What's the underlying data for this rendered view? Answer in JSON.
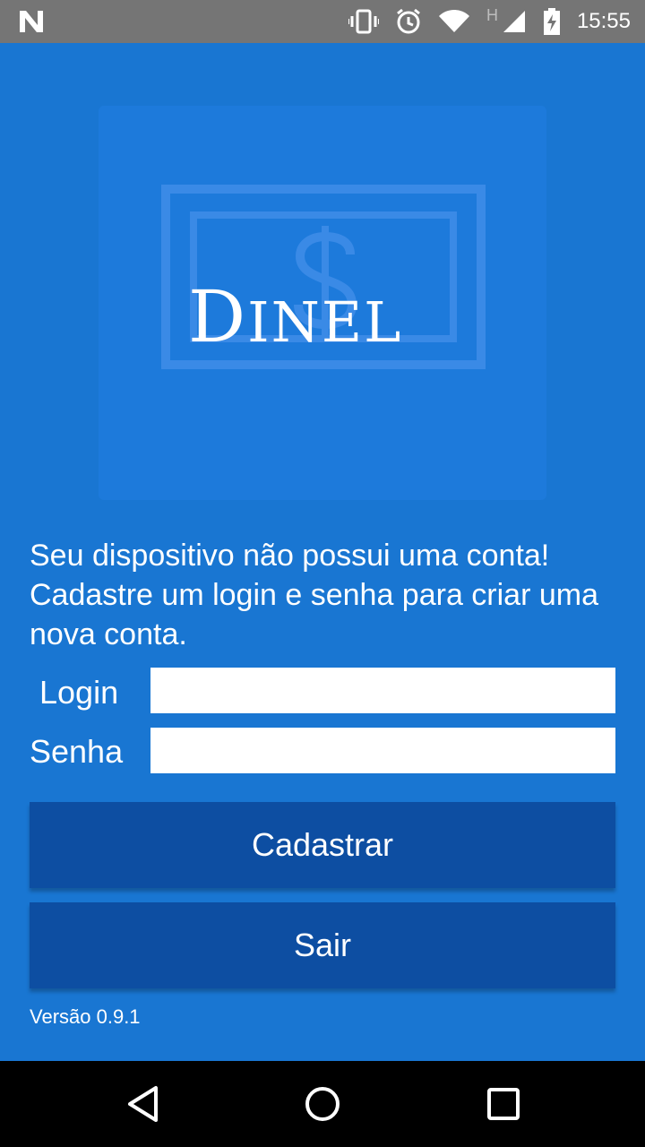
{
  "status_bar": {
    "time": "15:55",
    "network_type": "H",
    "icons": [
      "notification-n-icon",
      "vibrate-icon",
      "alarm-icon",
      "wifi-icon",
      "signal-icon",
      "battery-charging-icon"
    ]
  },
  "logo": {
    "text_first": "D",
    "text_rest": "INEL",
    "accent_color": "#3A8AE6"
  },
  "message": "Seu dispositivo não possui uma conta! Cadastre um login e senha para criar uma nova conta.",
  "form": {
    "login_label": "Login",
    "login_value": "",
    "password_label": "Senha",
    "password_value": ""
  },
  "buttons": {
    "register_label": "Cadastrar",
    "exit_label": "Sair"
  },
  "version": "Versão 0.9.1",
  "colors": {
    "background": "#1976D2",
    "button": "#0D4EA2",
    "status_bar": "#757575",
    "nav_bar": "#000000"
  },
  "nav_bar": {
    "icons": [
      "back-icon",
      "home-icon",
      "recents-icon"
    ]
  }
}
